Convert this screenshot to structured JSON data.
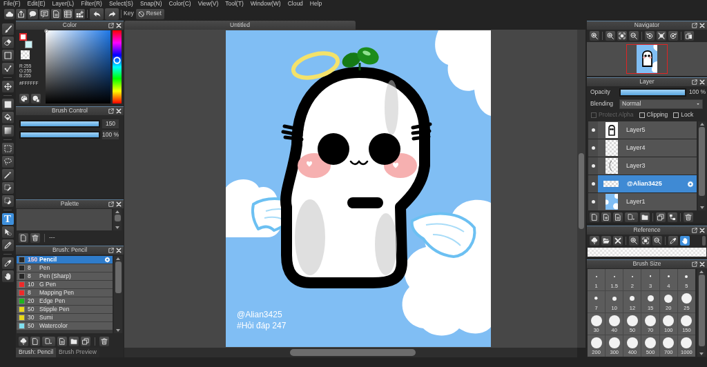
{
  "menu": [
    "File(F)",
    "Edit(E)",
    "Layer(L)",
    "Filter(R)",
    "Select(S)",
    "Snap(N)",
    "Color(C)",
    "View(V)",
    "Tool(T)",
    "Window(W)",
    "Cloud",
    "Help"
  ],
  "toolbar": {
    "key_label": "Key",
    "reset_label": "Reset"
  },
  "tool_groups": [
    [
      {
        "kind": "brush",
        "selected": false
      },
      {
        "kind": "eraser",
        "selected": false
      },
      {
        "kind": "rectangle",
        "selected": false
      },
      {
        "kind": "polyline",
        "selected": false
      }
    ],
    [
      {
        "kind": "move",
        "selected": false
      }
    ],
    [
      {
        "kind": "square",
        "selected": false
      },
      {
        "kind": "bucket",
        "selected": false
      },
      {
        "kind": "gradient",
        "selected": false
      }
    ],
    [
      {
        "kind": "select",
        "selected": false
      },
      {
        "kind": "lasso",
        "selected": false
      },
      {
        "kind": "wand",
        "selected": false
      },
      {
        "kind": "selectpen",
        "selected": false
      },
      {
        "kind": "selecteraser",
        "selected": false
      }
    ],
    [
      {
        "kind": "text",
        "label": "T",
        "selected": true
      },
      {
        "kind": "cursor",
        "selected": false
      },
      {
        "kind": "pen",
        "selected": false
      }
    ],
    [
      {
        "kind": "eyedropper",
        "selected": false
      },
      {
        "kind": "hand",
        "selected": false
      }
    ]
  ],
  "color_panel": {
    "title": "Color",
    "swatches": [
      {
        "color": "#ffffff",
        "selected": true
      },
      {
        "color": "#c9f1f5",
        "selected": false
      }
    ],
    "channels": [
      "R:255",
      "G:255",
      "B:255"
    ],
    "hex": "#FFFFFF",
    "hue": {
      "level": 0.59
    }
  },
  "brush_control": {
    "title": "Brush Control",
    "sliders": [
      {
        "level": 1,
        "reading": "150"
      },
      {
        "level": 1,
        "reading": "100 %"
      }
    ]
  },
  "palette": {
    "title": "Palette",
    "footer_text": "---"
  },
  "brush_panel": {
    "title": "Brush: Pencil",
    "brushes": [
      {
        "color": "#262626",
        "size": "150",
        "name": "Pencil",
        "selected": true
      },
      {
        "color": "#262626",
        "size": "8",
        "name": "Pen",
        "selected": false
      },
      {
        "color": "#262626",
        "size": "8",
        "name": "Pen (Sharp)",
        "selected": false
      },
      {
        "color": "#ee2a2a",
        "size": "10",
        "name": "G Pen",
        "selected": false
      },
      {
        "color": "#ee2a2a",
        "size": "8",
        "name": "Mapping Pen",
        "selected": false
      },
      {
        "color": "#1fb41f",
        "size": "20",
        "name": "Edge Pen",
        "selected": false
      },
      {
        "color": "#e8d81a",
        "size": "50",
        "name": "Stipple Pen",
        "selected": false
      },
      {
        "color": "#e8d81a",
        "size": "30",
        "name": "Sumi",
        "selected": false
      },
      {
        "color": "#80e0f0",
        "size": "50",
        "name": "Watercolor",
        "selected": false
      }
    ],
    "tabs": [
      {
        "label": "Brush: Pencil",
        "selected": true
      },
      {
        "label": "Brush Preview",
        "selected": false
      }
    ]
  },
  "canvas": {
    "tab": "Untitled",
    "texts": [
      "@Alian3425",
      "#Hỏi đáp 247"
    ]
  },
  "navigator": {
    "title": "Navigator"
  },
  "layer_panel": {
    "title": "Layer",
    "opacity": {
      "label": "Opacity",
      "level": 1,
      "reading": "100 %"
    },
    "blending": {
      "label": "Blending",
      "value": "Normal"
    },
    "options": [
      {
        "label": "Protect Alpha",
        "checked": false,
        "disabled": true
      },
      {
        "label": "Clipping",
        "checked": false,
        "disabled": false
      },
      {
        "label": "Lock",
        "checked": false,
        "disabled": false
      }
    ],
    "layers": [
      {
        "name": "Layer5",
        "kind": "figure",
        "visible": true,
        "selected": false
      },
      {
        "name": "Layer4",
        "kind": "blank",
        "visible": true,
        "selected": false
      },
      {
        "name": "Layer3",
        "kind": "sketch",
        "visible": true,
        "selected": false
      },
      {
        "name": "@Alian3425",
        "kind": "text",
        "visible": true,
        "selected": true
      },
      {
        "name": "Layer1",
        "kind": "sky",
        "visible": true,
        "selected": false
      }
    ]
  },
  "reference": {
    "title": "Reference",
    "button_groups": [
      [
        {
          "kind": "import",
          "selected": false
        },
        {
          "kind": "folder",
          "selected": false
        },
        {
          "kind": "close",
          "selected": false
        }
      ],
      [
        {
          "kind": "zoomin",
          "selected": false
        },
        {
          "kind": "fit",
          "selected": false
        },
        {
          "kind": "zoomout",
          "selected": false
        }
      ],
      [
        {
          "kind": "eyedropper",
          "selected": false
        },
        {
          "kind": "hand",
          "selected": true
        }
      ]
    ]
  },
  "brush_size": {
    "title": "Brush Size",
    "sizes": [
      "1",
      "1.5",
      "2",
      "3",
      "4",
      "5",
      "7",
      "10",
      "12",
      "15",
      "20",
      "25",
      "30",
      "40",
      "50",
      "70",
      "100",
      "150",
      "200",
      "300",
      "400",
      "500",
      "700",
      "1000"
    ]
  }
}
